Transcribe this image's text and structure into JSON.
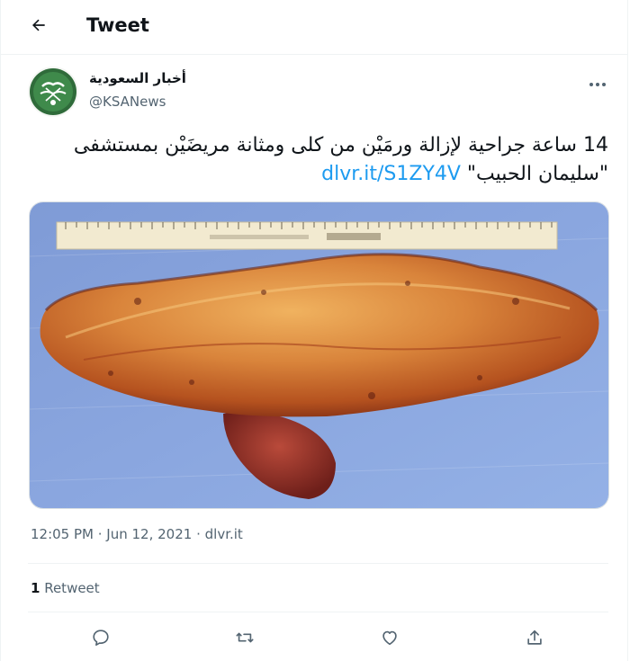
{
  "header": {
    "title": "Tweet",
    "back_icon": "back-arrow-icon"
  },
  "author": {
    "name": "أخبار السعودية",
    "handle": "@KSANews",
    "avatar_icon": "ksa-emblem-avatar",
    "more_icon": "more-dots-icon"
  },
  "tweet": {
    "text": "14 ساعة جراحية لإزالة ورمَيْن من كلى ومثانة مريضَيْن بمستشفى \"سليمان الحبيب\" ",
    "link": "dlvr.it/S1ZY4V",
    "image_alt": "surgical specimen next to ruler"
  },
  "meta": {
    "time": "12:05 PM",
    "sep1": " · ",
    "date": "Jun 12, 2021",
    "sep2": " · ",
    "source": "dlvr.it"
  },
  "stats": {
    "retweet_count": "1",
    "retweet_label": " Retweet"
  },
  "actions": [
    "reply-icon",
    "retweet-icon",
    "like-icon",
    "share-icon"
  ],
  "colors": {
    "link": "#1d9bf0",
    "secondary": "#536471",
    "text": "#0f1419",
    "border": "#eff3f4"
  }
}
